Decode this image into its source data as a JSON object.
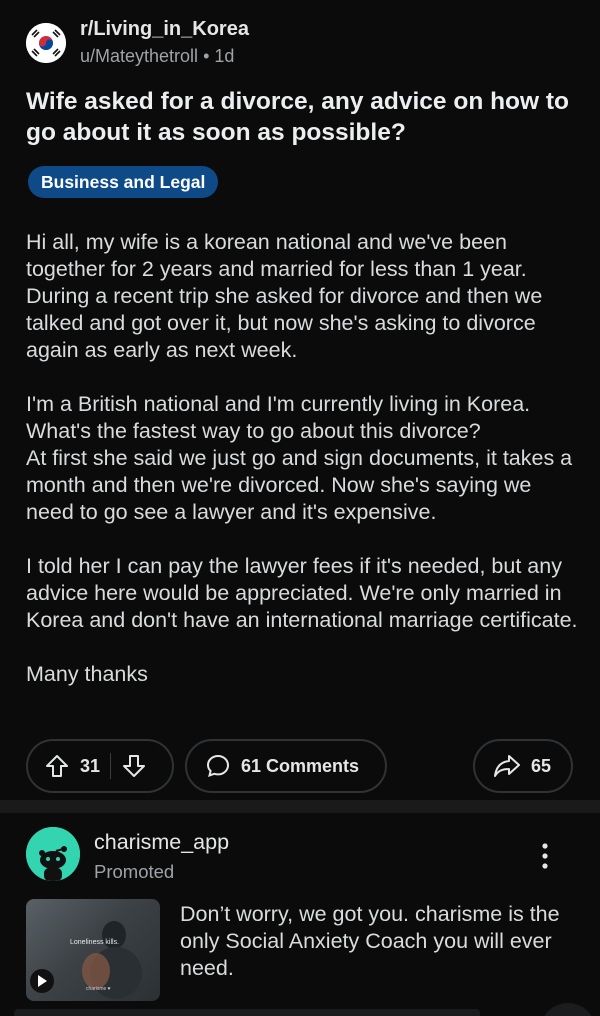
{
  "post": {
    "subreddit": "r/Living_in_Korea",
    "author": "u/Mateythetroll",
    "separator": "•",
    "age": "1d",
    "subreddit_icon": "south-korea-flag-icon",
    "title": "Wife asked for a divorce, any advice on how to go about it as soon as possible?",
    "flair": "Business and Legal",
    "flair_color": "#0d4a87",
    "body": [
      "Hi all, my wife is a korean national and we've been together for 2 years and married for less than 1 year. During a recent trip she asked for divorce and then we talked and got over it, but now she's asking to divorce again as early as next week.",
      "I'm a British national and I'm currently living in Korea.\nWhat's the fastest way to go about this divorce?\nAt first she said we just go and sign documents,  it takes a month and then we're divorced. Now she's saying we need to go see a lawyer and it's expensive.",
      "I told her I can pay the lawyer fees if it's needed, but any advice here would be appreciated. We're only married in Korea and don't have an international marriage certificate.",
      "Many thanks"
    ],
    "actions": {
      "upvotes": "31",
      "comments": "61 Comments",
      "shares": "65"
    }
  },
  "ad": {
    "name": "charisme_app",
    "promoted_label": "Promoted",
    "avatar_color": "#33d5b0",
    "text": "Don’t worry, we got you. charisme is the only Social Anxiety Coach you will ever need.",
    "thumbnail": {
      "caption": "Loneliness kills.",
      "brand": "charisme ♥"
    }
  }
}
